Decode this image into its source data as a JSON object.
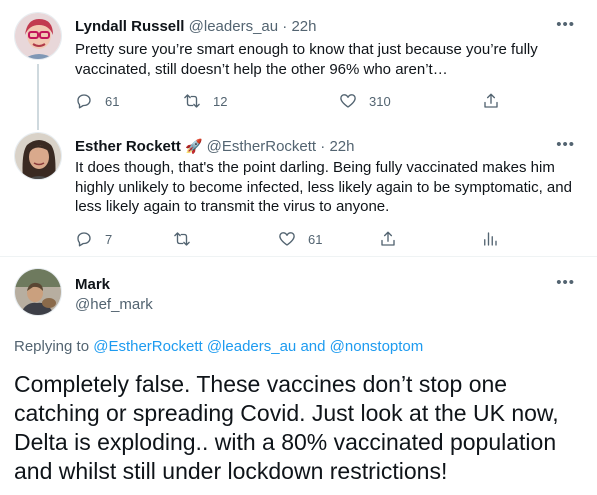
{
  "tweets": [
    {
      "name": "Lyndall Russell",
      "handle": "@leaders_au",
      "dot": "·",
      "time": "22h",
      "text": "Pretty sure you’re smart enough to know that just because you’re fully vaccinated, still doesn’t help the other 96% who aren’t…",
      "replies": "61",
      "retweets": "12",
      "likes": "310"
    },
    {
      "name": "Esther Rockett",
      "emoji": "🚀",
      "handle": "@EstherRockett",
      "dot": "·",
      "time": "22h",
      "text": "It does though, that's the point darling. Being fully vaccinated makes him highly unlikely to become infected, less likely again to be symptomatic, and less likely again to transmit the virus to anyone.",
      "replies": "7",
      "retweets": "",
      "likes": "61"
    }
  ],
  "main_tweet": {
    "name": "Mark",
    "handle": "@hef_mark",
    "replying_prefix": "Replying to",
    "replying_to": [
      "@EstherRockett",
      "@leaders_au"
    ],
    "replying_and": "and",
    "replying_last": "@nonstoptom",
    "text": "Completely false. These vaccines don’t stop one catching or spreading Covid. Just look at the UK now, Delta is exploding..  with a 80% vaccinated population and whilst still under lockdown restrictions!"
  },
  "more_glyph": "•••",
  "colors": {
    "text": "#0f1419",
    "secondary": "#536471",
    "link": "#1d9bf0",
    "rocket": "#1d9bf0"
  },
  "icons": [
    "reply-icon",
    "retweet-icon",
    "like-icon",
    "share-icon",
    "analytics-icon",
    "more-icon"
  ]
}
